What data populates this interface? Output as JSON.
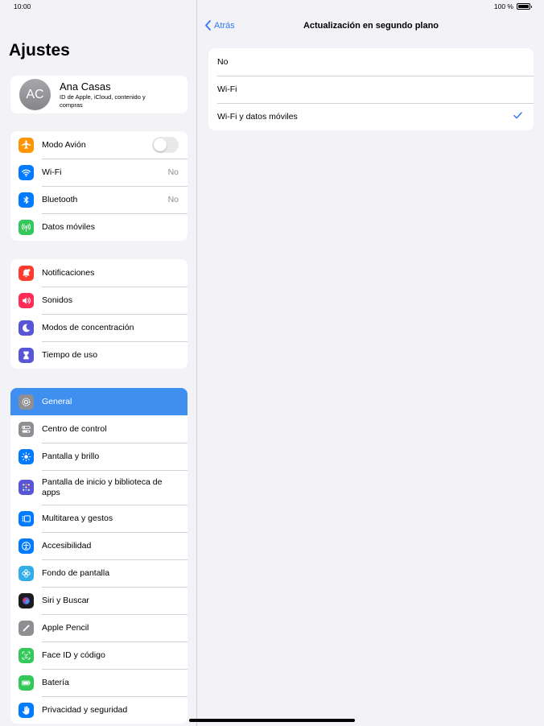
{
  "status": {
    "time": "10:00",
    "battery": "100 %"
  },
  "sidebar": {
    "title": "Ajustes",
    "profile": {
      "initials": "AC",
      "name": "Ana Casas",
      "subtitle": "ID de Apple, iCloud, contenido y compras"
    },
    "group1": [
      {
        "label": "Modo Avión",
        "icon": "airplane-icon",
        "color": "#ff9500",
        "toggle": false
      },
      {
        "label": "Wi-Fi",
        "icon": "wifi-icon",
        "color": "#007aff",
        "value": "No"
      },
      {
        "label": "Bluetooth",
        "icon": "bluetooth-icon",
        "color": "#007aff",
        "value": "No"
      },
      {
        "label": "Datos móviles",
        "icon": "antenna-icon",
        "color": "#34c759"
      }
    ],
    "group2": [
      {
        "label": "Notificaciones",
        "icon": "bell-icon",
        "color": "#ff3b30"
      },
      {
        "label": "Sonidos",
        "icon": "speaker-icon",
        "color": "#ff2d55"
      },
      {
        "label": "Modos de concentración",
        "icon": "moon-icon",
        "color": "#5856d6"
      },
      {
        "label": "Tiempo de uso",
        "icon": "hourglass-icon",
        "color": "#5856d6"
      }
    ],
    "group3": [
      {
        "label": "General",
        "icon": "gear-icon",
        "color": "#8e8e93",
        "selected": true
      },
      {
        "label": "Centro de control",
        "icon": "switches-icon",
        "color": "#8e8e93"
      },
      {
        "label": "Pantalla y brillo",
        "icon": "sun-icon",
        "color": "#007aff"
      },
      {
        "label": "Pantalla de inicio y biblioteca de apps",
        "icon": "app-grid-icon",
        "color": "#5856d6"
      },
      {
        "label": "Multitarea y gestos",
        "icon": "multitask-icon",
        "color": "#007aff"
      },
      {
        "label": "Accesibilidad",
        "icon": "accessibility-icon",
        "color": "#007aff"
      },
      {
        "label": "Fondo de pantalla",
        "icon": "flower-icon",
        "color": "#32ade6"
      },
      {
        "label": "Siri y Buscar",
        "icon": "siri-icon",
        "color": "#1c1c1e"
      },
      {
        "label": "Apple Pencil",
        "icon": "pencil-icon",
        "color": "#8e8e93"
      },
      {
        "label": "Face ID y código",
        "icon": "faceid-icon",
        "color": "#34c759"
      },
      {
        "label": "Batería",
        "icon": "battery-icon",
        "color": "#34c759"
      },
      {
        "label": "Privacidad y seguridad",
        "icon": "hand-icon",
        "color": "#007aff"
      }
    ]
  },
  "detail": {
    "back_label": "Atrás",
    "title": "Actualización en segundo plano",
    "options": [
      {
        "label": "No",
        "checked": false
      },
      {
        "label": "Wi-Fi",
        "checked": false
      },
      {
        "label": "Wi-Fi y datos móviles",
        "checked": true
      }
    ],
    "check_glyph": "✓"
  }
}
